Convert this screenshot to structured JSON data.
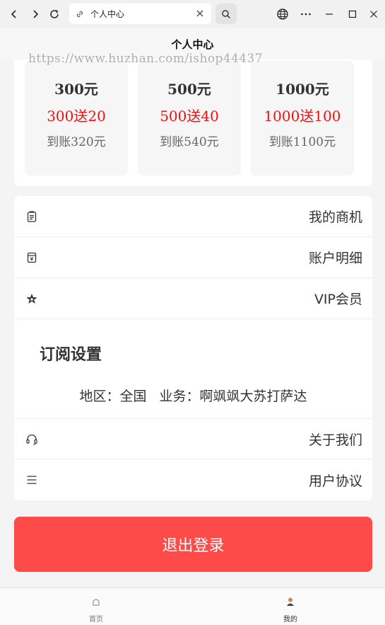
{
  "browser": {
    "tab_title": "个人中心"
  },
  "header": {
    "title": "个人中心",
    "watermark": "https://www.huzhan.com/ishop44437"
  },
  "recharge": {
    "packages": [
      {
        "amount": "300元",
        "bonus": "300送20",
        "arrive": "到账320元"
      },
      {
        "amount": "500元",
        "bonus": "500送40",
        "arrive": "到账540元"
      },
      {
        "amount": "1000元",
        "bonus": "1000送100",
        "arrive": "到账1100元"
      }
    ]
  },
  "menu": {
    "items": [
      {
        "label": "我的商机",
        "icon": "clipboard-icon"
      },
      {
        "label": "账户明细",
        "icon": "receipt-icon"
      },
      {
        "label": "VIP会员",
        "icon": "star-icon"
      },
      {
        "label": "关于我们",
        "icon": "headset-icon"
      },
      {
        "label": "用户协议",
        "icon": "list-icon"
      }
    ]
  },
  "subscription": {
    "title": "订阅设置",
    "region": "地区：全国",
    "business": "业务：啊飒飒大苏打萨达"
  },
  "logout": {
    "label": "退出登录"
  },
  "tabbar": {
    "items": [
      {
        "label": "首页",
        "icon": "home-icon"
      },
      {
        "label": "我的",
        "icon": "user-icon"
      }
    ]
  },
  "colors": {
    "accent_red": "#ff4a4a",
    "bonus_red": "#ee1111"
  }
}
